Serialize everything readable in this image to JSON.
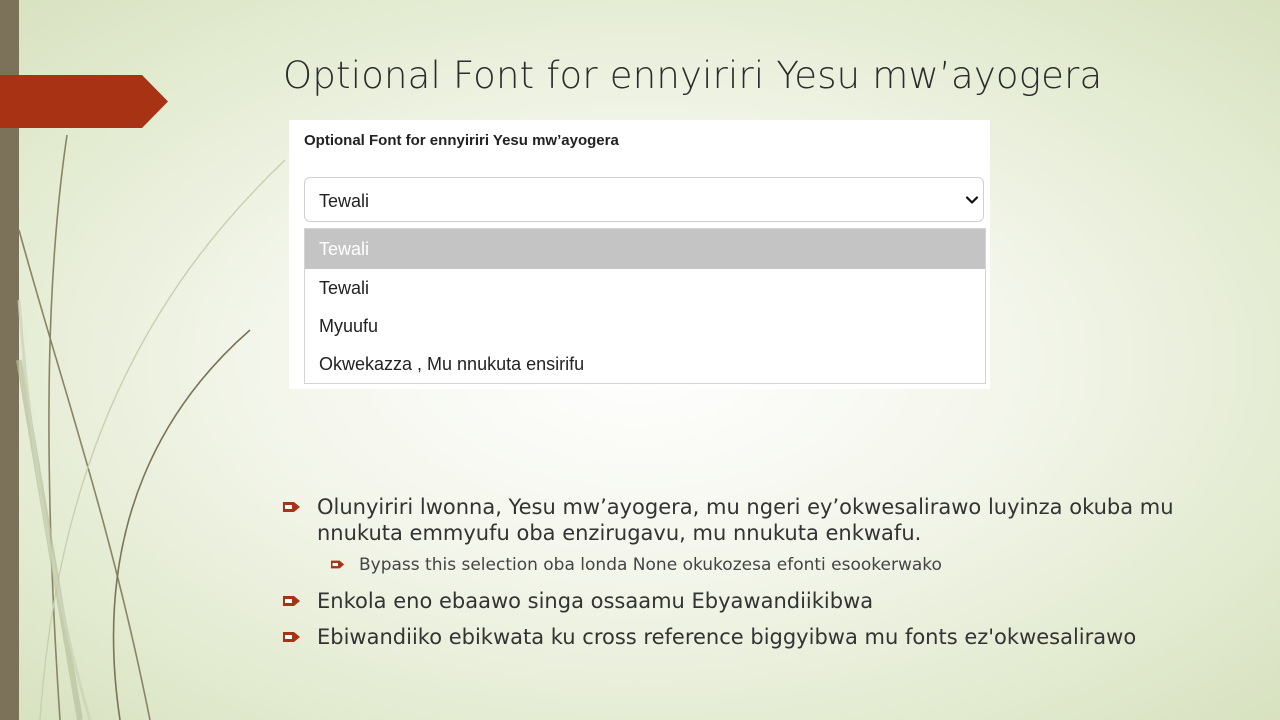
{
  "slide": {
    "title": "Optional Font for ennyiriri Yesu mw’ayogera"
  },
  "screenshot": {
    "label": "Optional Font for ennyiriri Yesu mw’ayogera",
    "select_value": "Tewali",
    "options": [
      "Tewali",
      "Tewali",
      "Myuufu",
      "Okwekazza , Mu nnukuta ensirifu"
    ],
    "selected_index": 0
  },
  "bullets": [
    "Olunyiriri lwonna, Yesu mw’ayogera, mu ngeri ey’okwesalirawo luyinza okuba mu nnukuta emmyufu oba enzirugavu, mu nnukuta enkwafu.",
    "Bypass this selection oba londa None okukozesa efonti esookerwako",
    "Enkola eno ebaawo singa ossaamu Ebyawandiikibwa",
    "Ebiwandiiko ebikwata ku cross reference biggyibwa mu fonts ez'okwesalirawo"
  ],
  "colors": {
    "accent": "#a83214",
    "left_bar": "#7b7259",
    "background": "#e3ebd1"
  },
  "icons": {
    "bullet": "arrow-bullet-icon",
    "select": "chevron-down-icon"
  }
}
